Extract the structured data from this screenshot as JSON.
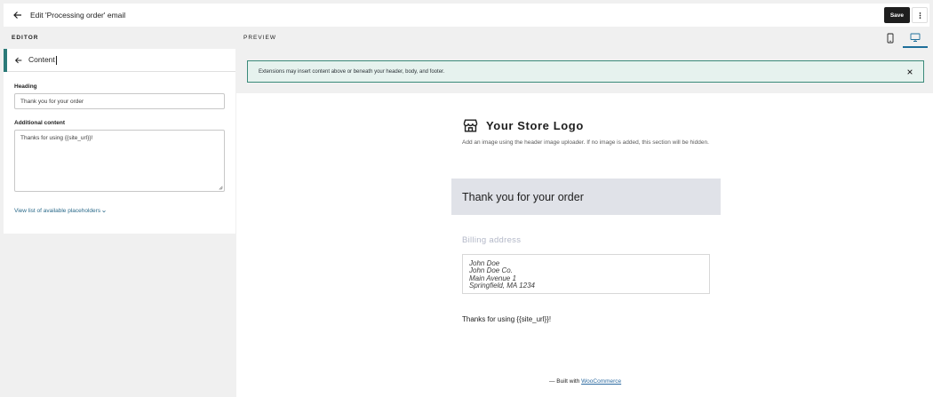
{
  "header": {
    "title": "Edit 'Processing order' email",
    "save_label": "Save"
  },
  "editor": {
    "section_label": "EDITOR",
    "panel_title": "Content",
    "heading_label": "Heading",
    "heading_value": "Thank you for your order",
    "additional_label": "Additional content",
    "additional_value": "Thanks for using {{site_url}}!",
    "placeholders_link": "View list of available placeholders"
  },
  "preview": {
    "section_label": "PREVIEW",
    "notice": "Extensions may insert content above or beneath your header, body, and footer.",
    "store_name": "Your Store Logo",
    "header_note": "Add an image using the header image uploader. If no image is added, this section will be hidden.",
    "email_heading": "Thank you for your order",
    "billing_title": "Billing address",
    "address": [
      "John Doe",
      "John Doe Co.",
      "Main Avenue 1",
      "Springfield, MA 1234"
    ],
    "thanks": "Thanks for using {{site_url}}!",
    "footer_prefix": "— Built with ",
    "footer_link": "WooCommerce"
  },
  "icons": {
    "back": "arrow-left-icon",
    "more": "more-vertical-icon",
    "mobile": "mobile-icon",
    "desktop": "desktop-icon",
    "close": "close-icon",
    "chevron": "chevron-down-icon",
    "store": "store-icon"
  },
  "colors": {
    "accent": "#2b7a78",
    "notice_bg": "#e6f2ee",
    "heading_bar": "#e0e2e8",
    "link": "#2b6aa0"
  }
}
